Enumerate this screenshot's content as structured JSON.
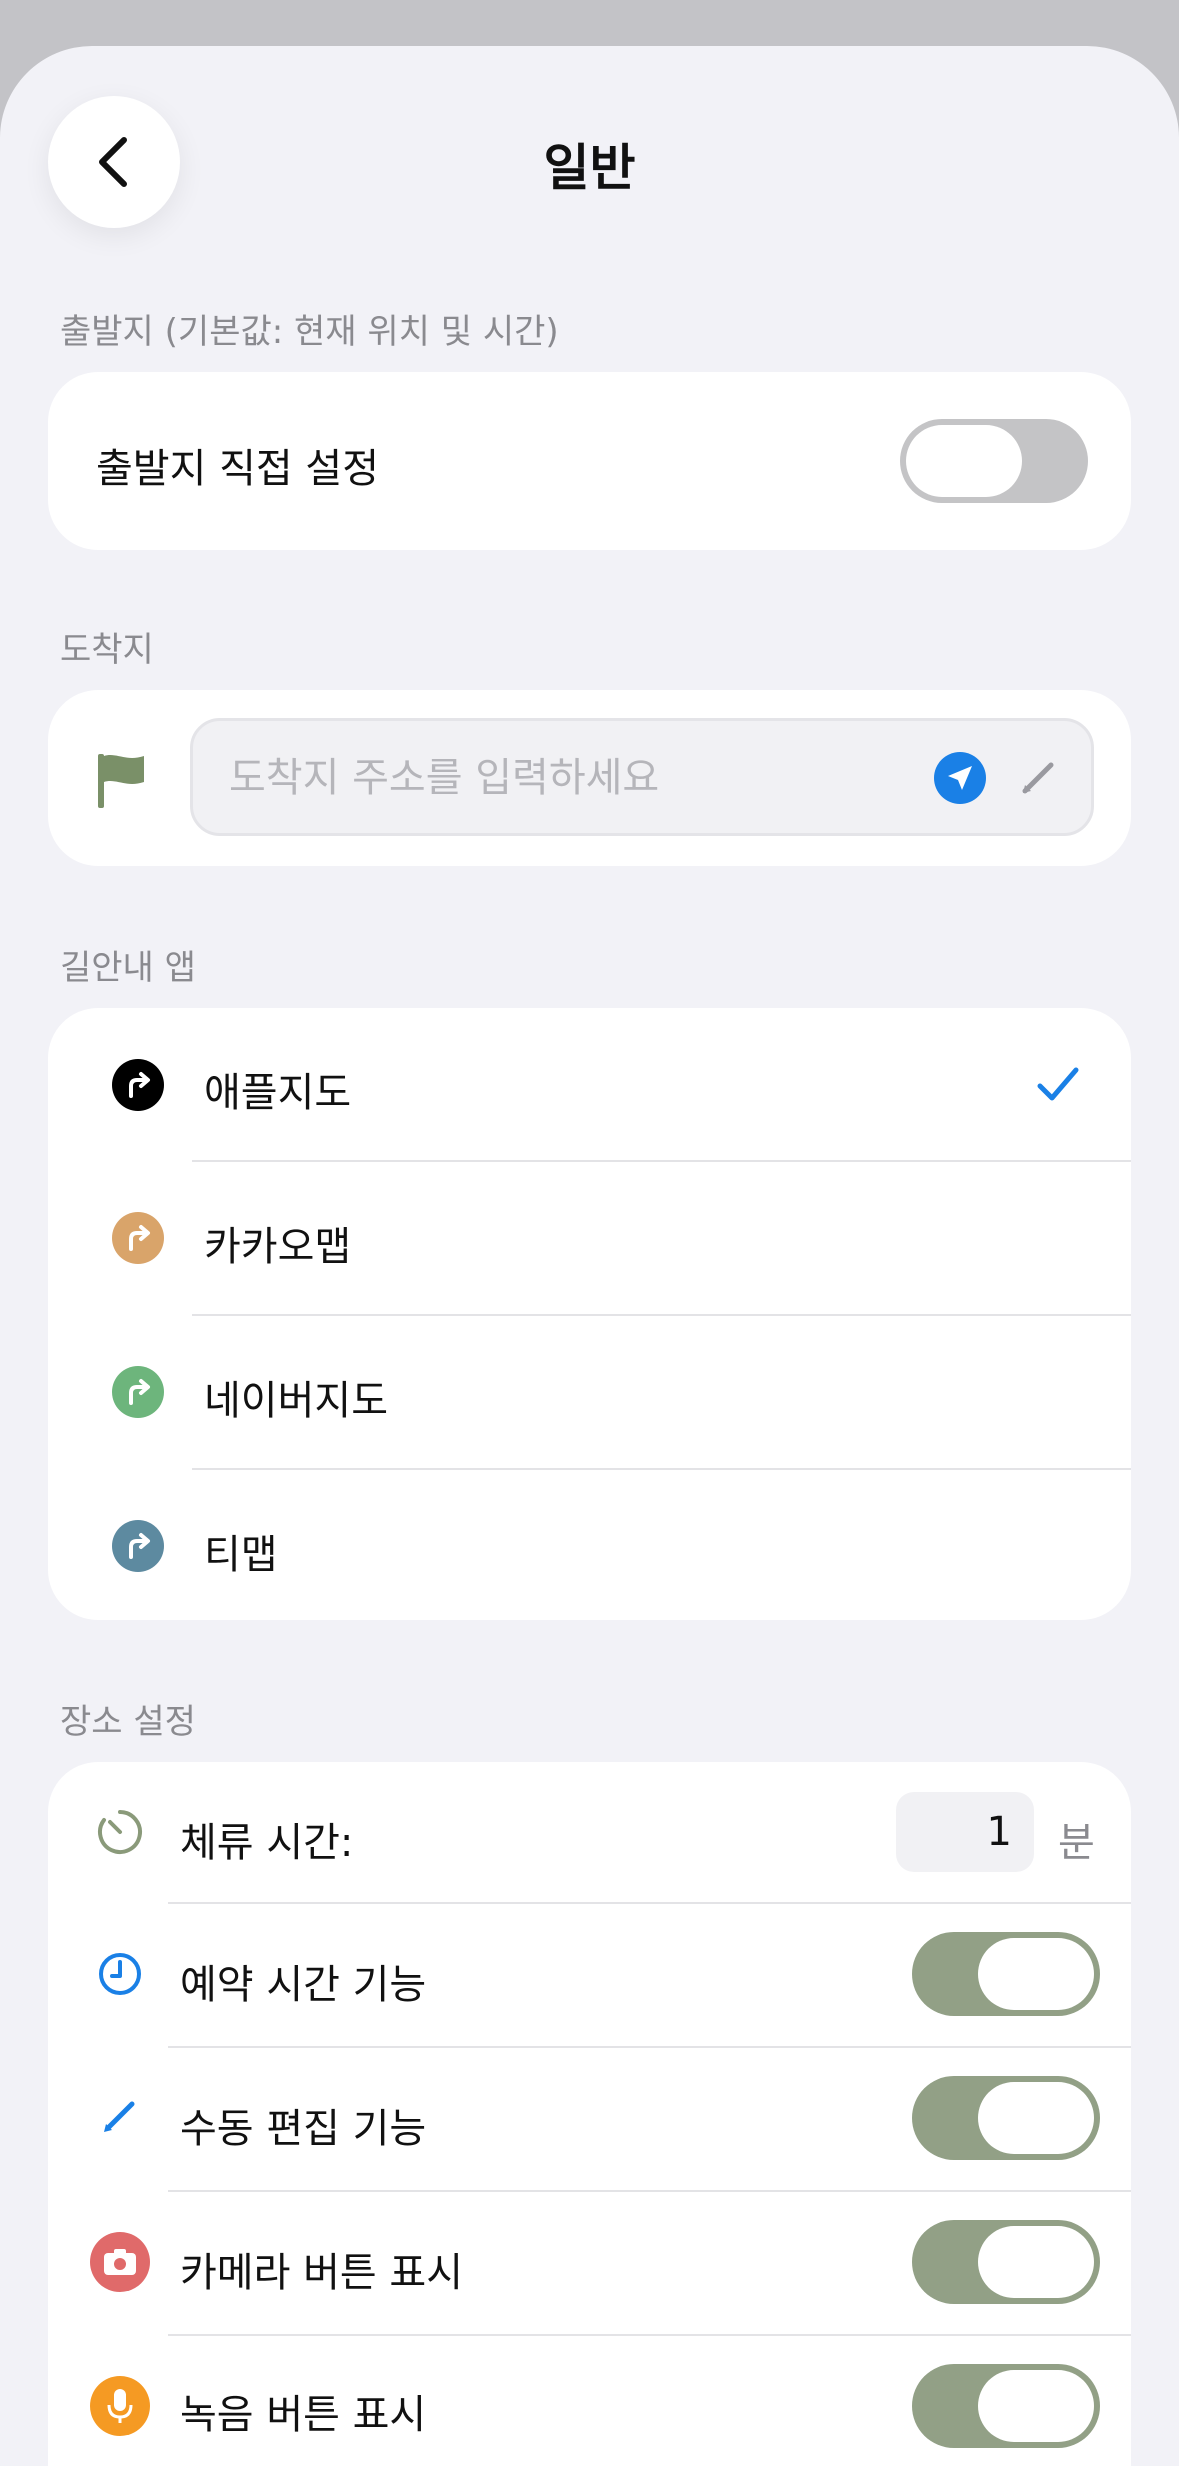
{
  "header": {
    "title": "일반"
  },
  "origin": {
    "section_label": "출발지 (기본값: 현재 위치 및 시간)",
    "toggle_label": "출발지 직접 설정",
    "toggle_on": false
  },
  "destination": {
    "section_label": "도착지",
    "placeholder": "도착지 주소를 입력하세요",
    "value": ""
  },
  "nav_apps": {
    "section_label": "길안내 앱",
    "items": [
      {
        "label": "애플지도",
        "color": "#000000",
        "selected": true
      },
      {
        "label": "카카오맵",
        "color": "#d9a46a",
        "selected": false
      },
      {
        "label": "네이버지도",
        "color": "#6db57c",
        "selected": false
      },
      {
        "label": "티맵",
        "color": "#5d8aa0",
        "selected": false
      }
    ]
  },
  "place_settings": {
    "section_label": "장소 설정",
    "stay_time": {
      "label": "체류 시간:",
      "value": "1",
      "unit": "분"
    },
    "toggles": [
      {
        "label": "예약 시간 기능",
        "on": true
      },
      {
        "label": "수동 편집 기능",
        "on": true
      },
      {
        "label": "카메라 버튼 표시",
        "on": true
      },
      {
        "label": "녹음 버튼 표시",
        "on": true
      }
    ]
  },
  "colors": {
    "accent_blue": "#1a80e6",
    "toggle_on": "#92a086",
    "toggle_off": "#c4c4c6",
    "flag_green": "#7a9068",
    "camera_red": "#e06a6a",
    "mic_orange": "#f59a23"
  }
}
